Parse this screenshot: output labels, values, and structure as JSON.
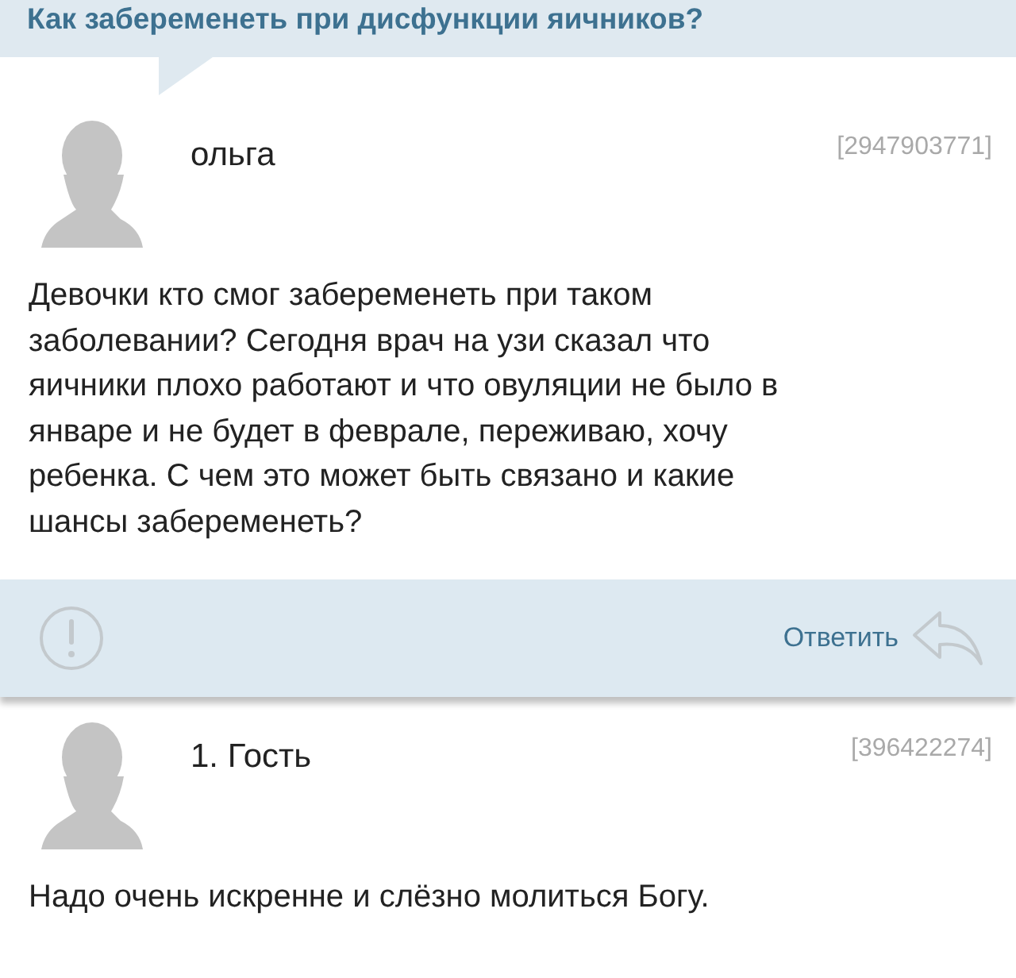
{
  "topic_title": "Как забеременеть при дисфункции яичников?",
  "posts": [
    {
      "author": "ольга",
      "id_tag": "[2947903771]",
      "text": "Девочки кто смог забеременеть при таком заболевании? Сегодня врач на узи сказал что яичники плохо работают и что овуляции не было в январе и не будет в феврале, переживаю, хочу ребенка. С чем это может быть связано и какие шансы забеременеть?",
      "actions": {
        "reply_label": "Ответить"
      }
    },
    {
      "author": "1. Гость",
      "id_tag": "[396422274]",
      "text": "Надо очень искренне и слёзно молиться Богу."
    }
  ]
}
